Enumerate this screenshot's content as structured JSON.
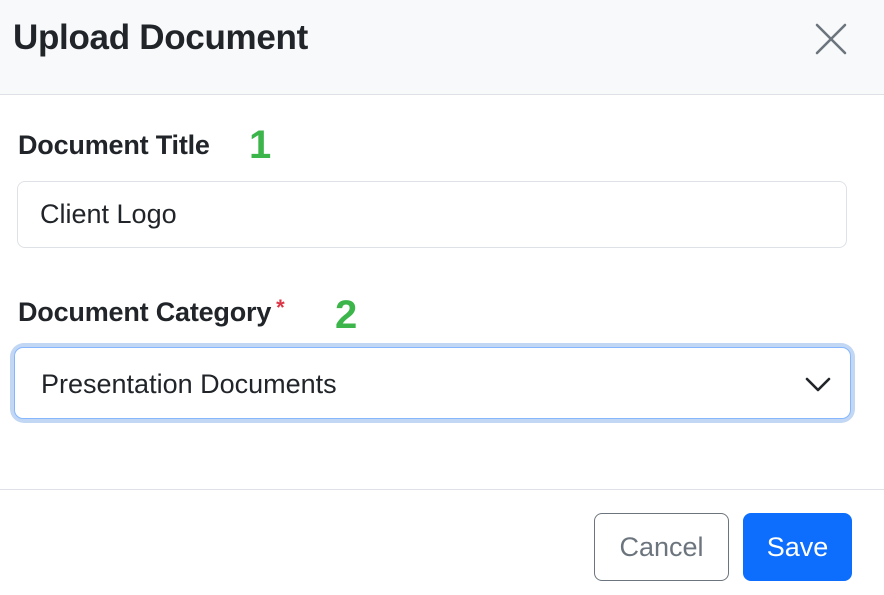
{
  "modal": {
    "title": "Upload Document",
    "close_icon": "close-icon"
  },
  "fields": {
    "title": {
      "label": "Document Title",
      "step": "1",
      "value": "Client Logo"
    },
    "category": {
      "label": "Document Category",
      "required_marker": "*",
      "step": "2",
      "selected": "Presentation Documents",
      "dropdown_icon": "chevron-down-icon"
    }
  },
  "footer": {
    "cancel_label": "Cancel",
    "save_label": "Save"
  },
  "colors": {
    "primary": "#0d6efd",
    "step_marker": "#3cb54a",
    "required": "#dc3545",
    "focus_ring": "#c2d7f4"
  }
}
